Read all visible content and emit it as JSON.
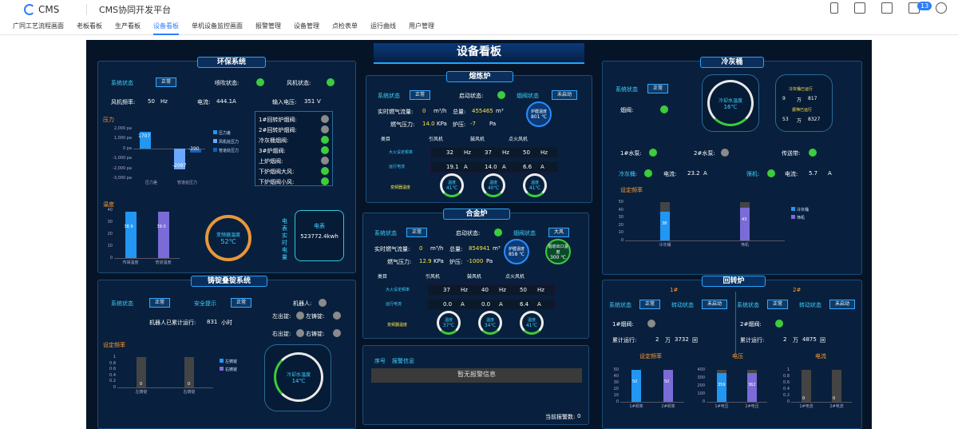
{
  "header": {
    "logo": "CMS",
    "app_title": "CMS协同开发平台",
    "badge_count": "13"
  },
  "nav": [
    "广同工艺流程画面",
    "老板看板",
    "生产看板",
    "设备看板",
    "单机设备监控画面",
    "报警管理",
    "设备管理",
    "点检表单",
    "运行曲线",
    "用户管理"
  ],
  "board_title": "设备看板",
  "env": {
    "title": "环保系统",
    "sys_status_label": "系统状态",
    "sys_status": "正常",
    "spray_label": "喷吹状态:",
    "fan_label": "风机状态:",
    "fan_freq_label": "风机频率:",
    "fan_freq": "50",
    "fan_freq_unit": "Hz",
    "current_label": "电流:",
    "current": "444.1",
    "current_unit": "A",
    "input_voltage_label": "输入电压:",
    "input_voltage": "351",
    "input_voltage_unit": "V",
    "pressure_title": "压力",
    "valves": [
      {
        "label": "1#回转炉烟阀:",
        "on": false
      },
      {
        "label": "2#回转炉烟阀:",
        "on": false
      },
      {
        "label": "冷灰桶烟阀:",
        "on": true
      },
      {
        "label": "3#炉烟阀:",
        "on": true
      },
      {
        "label": "上炉烟阀:",
        "on": false
      },
      {
        "label": "下炉烟阀大风:",
        "on": true
      },
      {
        "label": "下炉烟阀小风:",
        "on": true
      }
    ],
    "temp_title": "温度",
    "trans_temp_label": "变频器温度",
    "trans_temp": "52℃",
    "meter_label": "电表",
    "meter_value": "523772.4kwh",
    "meter_side": "电表实时电量"
  },
  "env_chart": {
    "type": "bar",
    "ylim": [
      -3000,
      2000
    ],
    "yticks": [
      "2,000 pa",
      "1,000 pa",
      "0 pa",
      "-1,000 pa",
      "-2,000 pa",
      "-3,000 pa"
    ],
    "categories": [
      "压力差",
      "管道处压力"
    ],
    "series": [
      {
        "name": "压力差",
        "values": [
          1707,
          null
        ]
      },
      {
        "name": "风机处压力",
        "values": [
          null,
          -2097
        ]
      },
      {
        "name": "管道处压力",
        "values": [
          null,
          -390
        ]
      }
    ],
    "labels": [
      "1707",
      "-2097",
      "-390"
    ]
  },
  "temp_chart": {
    "type": "bar",
    "ylim": [
      0,
      40
    ],
    "yticks": [
      "40",
      "30",
      "20",
      "10",
      "0"
    ],
    "categories": [
      "布袋温度",
      "管道温度"
    ],
    "values": [
      38.9,
      39.0
    ],
    "labels": [
      "38.9",
      "39.0"
    ]
  },
  "casting": {
    "title": "铸锭叠锭系统",
    "sys_status_label": "系统状态",
    "sys_status": "正常",
    "safety_label": "安全提示",
    "safety": "正常",
    "robot_label": "机器人:",
    "runtime_label": "机器人已累计运行:",
    "runtime": "831",
    "runtime_unit": "小时",
    "left_out": "左出锭:",
    "left_ingot": "左铸锭:",
    "right_out": "右出锭:",
    "right_ingot": "右铸锭:",
    "freq_title": "设定频率",
    "cool_label": "冷却水温度",
    "cool_value": "14℃"
  },
  "cast_chart": {
    "type": "bar",
    "ylim": [
      0,
      1
    ],
    "yticks": [
      "1",
      "0.8",
      "0.6",
      "0.4",
      "0.2",
      "0"
    ],
    "categories": [
      "左铸锭",
      "右铸锭"
    ],
    "values": [
      0,
      0
    ],
    "legend": [
      "左铸锭",
      "右铸锭"
    ]
  },
  "smelt": {
    "title": "熔炼炉",
    "sys_status_label": "系统状态",
    "sys_status": "正常",
    "start_label": "启动状态:",
    "damper_label": "烟阀状态",
    "damper": "未启动",
    "gas_flow_label": "实时燃气流量:",
    "gas_flow": "0",
    "gas_flow_unit": "m³/h",
    "total_label": "总量:",
    "total": "455465",
    "total_unit": "m³",
    "gas_press_label": "燃气压力:",
    "gas_press": "14.0",
    "gas_press_unit": "KPa",
    "furnace_press_label": "炉压:",
    "furnace_press": "-7",
    "furnace_press_unit": "Pa",
    "furnace_temp_label": "炉膛温度",
    "furnace_temp": "801 ℃",
    "cols": [
      "类目",
      "引风机",
      "鼓风机",
      "点火风机"
    ],
    "row1": {
      "label": "大火设定频率",
      "v": [
        "32",
        "37",
        "50"
      ],
      "u": "Hz"
    },
    "row2": {
      "label": "运行电流",
      "v": [
        "19.1",
        "14.0",
        "6.6"
      ],
      "u": "A"
    },
    "gauge_label": "变频器温度",
    "gauges": [
      {
        "name": "温度",
        "value": "41℃"
      },
      {
        "name": "温度",
        "value": "40℃"
      },
      {
        "name": "温度",
        "value": "41℃"
      }
    ]
  },
  "alloy": {
    "title": "合金炉",
    "sys_status_label": "系统状态",
    "sys_status": "正常",
    "start_label": "启动状态:",
    "damper_label": "烟阀状态",
    "damper": "大风",
    "gas_flow_label": "实时燃气流量:",
    "gas_flow": "0",
    "gas_flow_unit": "m³/h",
    "total_label": "总量:",
    "total": "854941",
    "total_unit": "m³",
    "gas_press_label": "燃气压力:",
    "gas_press": "12.9",
    "gas_press_unit": "KPa",
    "furnace_press_label": "炉压:",
    "furnace_press": "-1000",
    "furnace_press_unit": "Pa",
    "furnace_temp_label": "炉膛温度",
    "furnace_temp": "858 ℃",
    "outlet_temp_label": "烟道出口温度",
    "outlet_temp": "300 ℃",
    "cols": [
      "类目",
      "引风机",
      "鼓风机",
      "点火风机"
    ],
    "row1": {
      "label": "大火设定频率",
      "v": [
        "37",
        "40",
        "50"
      ],
      "u": "Hz"
    },
    "row2": {
      "label": "运行电流",
      "v": [
        "0.0",
        "0.0",
        "6.4"
      ],
      "u": "A"
    },
    "gauge_label": "变频器温度",
    "gauges": [
      {
        "name": "温度",
        "value": "37℃"
      },
      {
        "name": "温度",
        "value": "34℃"
      },
      {
        "name": "温度",
        "value": "41℃"
      }
    ]
  },
  "alarm": {
    "col1": "序号",
    "col2": "报警信息",
    "empty": "暂无报警信息",
    "count_label": "当前报警数:",
    "count": "0"
  },
  "ash": {
    "title": "冷灰桶",
    "sys_status_label": "系统状态",
    "sys_status": "正常",
    "damper_label": "烟阀:",
    "cool_label": "冷却水温度",
    "cool_value": "16℃",
    "cool_run_label": "冷灰桶已运行",
    "cool_run_days": "9",
    "cool_run_unit": "万",
    "cool_run_hours": "817",
    "screen_run_label": "振筛已运行",
    "screen_run_days": "53",
    "screen_run_unit": "万",
    "screen_run_hours": "8327",
    "pump1_label": "1#水泵:",
    "pump2_label": "2#水泵:",
    "conveyor_label": "传送带:",
    "ash_label": "冷灰桶:",
    "ash_current_label": "电流:",
    "ash_current": "23.2",
    "ash_current_unit": "A",
    "screen_label": "筛机:",
    "screen_current_label": "电流:",
    "screen_current": "5.7",
    "screen_current_unit": "A",
    "freq_title": "设定频率"
  },
  "ash_chart": {
    "type": "bar",
    "ylim": [
      0,
      50
    ],
    "yticks": [
      "50",
      "40",
      "30",
      "20",
      "10",
      "0"
    ],
    "categories": [
      "冷灰桶",
      "筛机"
    ],
    "values": [
      38,
      43
    ],
    "legend": [
      "冷灰桶",
      "筛机"
    ]
  },
  "rotary": {
    "title": "回转炉",
    "u1": "1#",
    "u2": "2#",
    "sys_status_label": "系统状态",
    "sys_status": "正常",
    "drive_label": "转动状态",
    "drive": "未启动",
    "damper1_label": "1#烟阀:",
    "damper2_label": "2#烟阀:",
    "run_label": "累计运行:",
    "run1_a": "2",
    "run1_b": "3732",
    "run2_a": "2",
    "run2_b": "4875",
    "wan": "万",
    "unit": "回",
    "freq_title": "设定频率",
    "volt_title": "电压",
    "curr_title": "电流"
  },
  "rot_freq": {
    "type": "bar",
    "ylim": [
      0,
      50
    ],
    "yticks": [
      "50",
      "40",
      "30",
      "20",
      "10",
      "0"
    ],
    "categories": [
      "1#频率",
      "2#频率"
    ],
    "values": [
      50,
      50
    ]
  },
  "rot_volt": {
    "type": "bar",
    "ylim": [
      0,
      400
    ],
    "yticks": [
      "400",
      "300",
      "200",
      "100",
      "0"
    ],
    "categories": [
      "1#电压",
      "2#电压"
    ],
    "values": [
      359,
      362
    ]
  },
  "rot_curr": {
    "type": "bar",
    "ylim": [
      0,
      1
    ],
    "yticks": [
      "1",
      "0.8",
      "0.6",
      "0.4",
      "0.2",
      "0"
    ],
    "categories": [
      "1#电流",
      "2#电流"
    ],
    "values": [
      0,
      0
    ]
  }
}
